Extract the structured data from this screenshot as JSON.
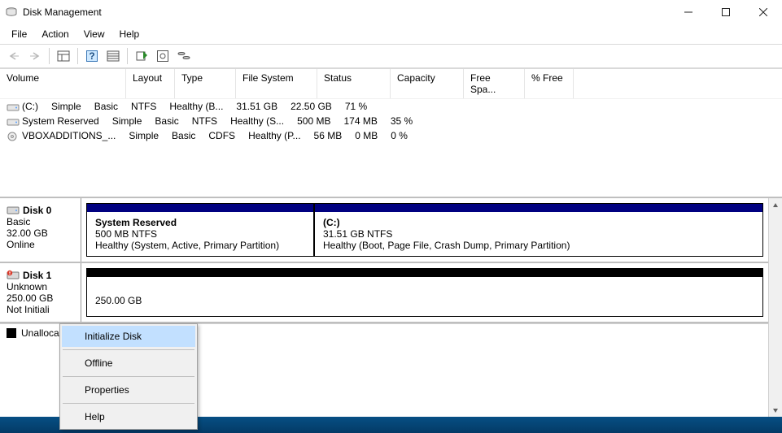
{
  "window": {
    "title": "Disk Management"
  },
  "menu": {
    "file": "File",
    "action": "Action",
    "view": "View",
    "help": "Help"
  },
  "columns": {
    "volume": "Volume",
    "layout": "Layout",
    "type": "Type",
    "filesystem": "File System",
    "status": "Status",
    "capacity": "Capacity",
    "free": "Free Spa...",
    "pct": "% Free"
  },
  "volumes": [
    {
      "name": "(C:)",
      "layout": "Simple",
      "type": "Basic",
      "fs": "NTFS",
      "status": "Healthy (B...",
      "capacity": "31.51 GB",
      "free": "22.50 GB",
      "pct": "71 %"
    },
    {
      "name": "System Reserved",
      "layout": "Simple",
      "type": "Basic",
      "fs": "NTFS",
      "status": "Healthy (S...",
      "capacity": "500 MB",
      "free": "174 MB",
      "pct": "35 %"
    },
    {
      "name": "VBOXADDITIONS_...",
      "layout": "Simple",
      "type": "Basic",
      "fs": "CDFS",
      "status": "Healthy (P...",
      "capacity": "56 MB",
      "free": "0 MB",
      "pct": "0 %"
    }
  ],
  "disk0": {
    "label": "Disk 0",
    "type": "Basic",
    "size": "32.00 GB",
    "state": "Online",
    "p0": {
      "name": "System Reserved",
      "size": "500 MB NTFS",
      "status": "Healthy (System, Active, Primary Partition)"
    },
    "p1": {
      "name": "(C:)",
      "size": "31.51 GB NTFS",
      "status": "Healthy (Boot, Page File, Crash Dump, Primary Partition)"
    }
  },
  "disk1": {
    "label": "Disk 1",
    "type": "Unknown",
    "size": "250.00 GB",
    "state": "Not Initialized",
    "p0": {
      "size": "250.00 GB"
    }
  },
  "legend": {
    "unallocated": "Unallocated"
  },
  "ctx": {
    "initialize": "Initialize Disk",
    "offline": "Offline",
    "properties": "Properties",
    "help": "Help"
  }
}
